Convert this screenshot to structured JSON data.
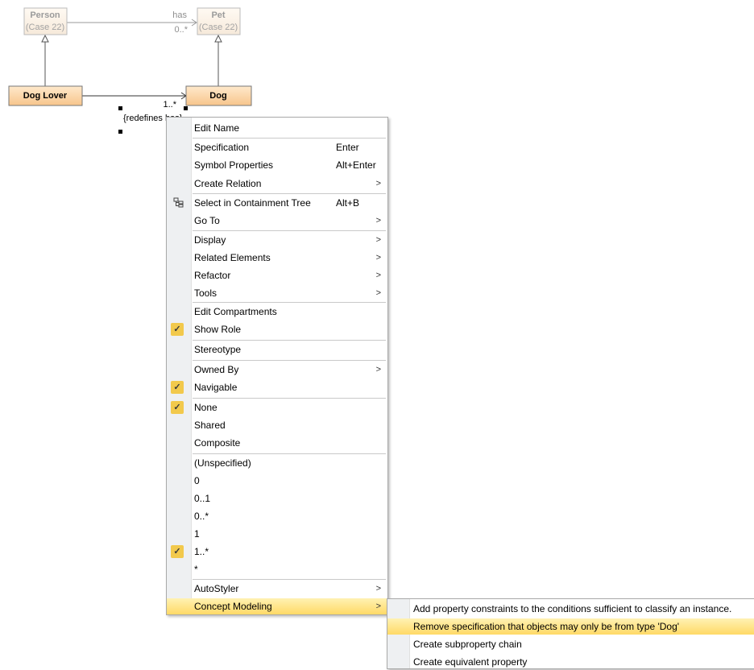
{
  "diagram": {
    "person": {
      "name": "Person",
      "case": "(Case 22)"
    },
    "pet": {
      "name": "Pet",
      "case": "(Case 22)"
    },
    "dog_lover": {
      "name": "Dog Lover"
    },
    "dog": {
      "name": "Dog"
    },
    "assoc_has": {
      "label": "has",
      "mult": "0..*"
    },
    "assoc_dog": {
      "mult": "1..*",
      "redefines": "{redefines has}"
    }
  },
  "context_menu": {
    "items": [
      {
        "label": "Edit Name"
      },
      {
        "label": "Specification",
        "shortcut": "Enter"
      },
      {
        "label": "Symbol Properties",
        "shortcut": "Alt+Enter"
      },
      {
        "label": "Create Relation",
        "submenu": ">"
      },
      {
        "label": "Select in Containment Tree",
        "shortcut": "Alt+B",
        "icon": "containment-tree-icon"
      },
      {
        "label": "Go To",
        "submenu": ">"
      },
      {
        "label": "Display",
        "submenu": ">"
      },
      {
        "label": "Related Elements",
        "submenu": ">"
      },
      {
        "label": "Refactor",
        "submenu": ">"
      },
      {
        "label": "Tools",
        "submenu": ">"
      },
      {
        "label": "Edit Compartments"
      },
      {
        "label": "Show Role",
        "checked": true
      },
      {
        "label": "Stereotype"
      },
      {
        "label": "Owned By",
        "submenu": ">"
      },
      {
        "label": "Navigable",
        "checked": true
      },
      {
        "label": "None",
        "checked": true
      },
      {
        "label": "Shared"
      },
      {
        "label": "Composite"
      },
      {
        "label": "(Unspecified)"
      },
      {
        "label": "0"
      },
      {
        "label": "0..1"
      },
      {
        "label": "0..*"
      },
      {
        "label": "1"
      },
      {
        "label": "1..*",
        "checked": true
      },
      {
        "label": "*"
      },
      {
        "label": "AutoStyler",
        "submenu": ">"
      },
      {
        "label": "Concept Modeling",
        "submenu": ">",
        "highlighted": true
      }
    ]
  },
  "submenu": {
    "items": [
      {
        "label": "Add property constraints to the conditions sufficient to classify an instance."
      },
      {
        "label": "Remove specification that objects may only be from type 'Dog'",
        "highlighted": true
      },
      {
        "label": "Create subproperty chain"
      },
      {
        "label": "Create equivalent property"
      }
    ]
  },
  "colors": {
    "class_fill": "#fbd6a8",
    "highlight": "#ffd966",
    "check": "#f2c94c"
  }
}
